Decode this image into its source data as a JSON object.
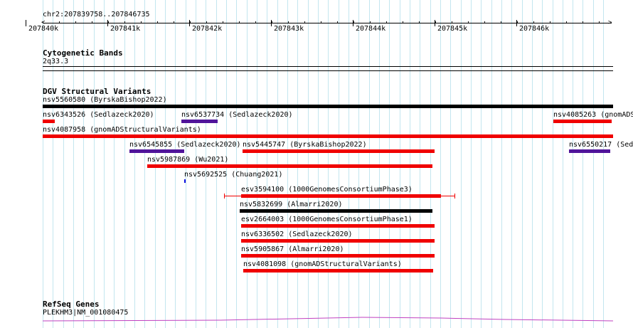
{
  "colors": {
    "grid": "#c3e6ef",
    "red": "#f00000",
    "purple": "#50149a",
    "blue": "#1010e0",
    "black": "#000000",
    "gene": "#c040c0"
  },
  "ruler": {
    "range_label": "chr2:207839758..207846735",
    "ticks": [
      {
        "label": "207840k",
        "pos": 0.035
      },
      {
        "label": "207841k",
        "pos": 0.178
      },
      {
        "label": "207842k",
        "pos": 0.322
      },
      {
        "label": "207843k",
        "pos": 0.465
      },
      {
        "label": "207844k",
        "pos": 0.608
      },
      {
        "label": "207845k",
        "pos": 0.752
      },
      {
        "label": "207846k",
        "pos": 0.895
      }
    ]
  },
  "tracks": {
    "cytoband": {
      "title": "Cytogenetic Bands",
      "band": "2q33.3"
    },
    "dgv": {
      "title": "DGV Structural Variants",
      "features": [
        {
          "label": "nsv5560580 (ByrskaBishop2022)",
          "start": 0,
          "end": 1,
          "color": "black"
        },
        {
          "label": "nsv6343526 (Sedlazeck2020)",
          "start": 0,
          "end": 0.021,
          "color": "red"
        },
        {
          "label": "nsv6537734 (Sedlazeck2020)",
          "start": 0.243,
          "end": 0.307,
          "color": "purple"
        },
        {
          "label": "nsv4085263 (gnomADS",
          "start": 0.895,
          "end": 0.998,
          "color": "red"
        },
        {
          "label": "nsv4087958 (gnomADStructuralVariants)",
          "start": 0,
          "end": 1,
          "color": "red"
        },
        {
          "label": "nsv6545855 (Sedlazeck2020)",
          "start": 0.152,
          "end": 0.248,
          "color": "purple"
        },
        {
          "label": "nsv5445747 (ByrskaBishop2022)",
          "start": 0.35,
          "end": 0.687,
          "color": "red"
        },
        {
          "label": "nsv6550217 (Sed",
          "start": 0.923,
          "end": 0.995,
          "color": "purple"
        },
        {
          "label": "nsv5987869 (Wu2021)",
          "start": 0.183,
          "end": 0.683,
          "color": "red"
        },
        {
          "label": "nsv5692525 (Chuang2021)",
          "start": 0.248,
          "end": 0.251,
          "color": "blue"
        },
        {
          "label": "esv3594100 (1000GenomesConsortiumPhase3)",
          "start": 0.348,
          "end": 0.698,
          "color": "red",
          "whisker_start": 0.318,
          "whisker_end": 0.722
        },
        {
          "label": "nsv5832699 (Almarri2020)",
          "start": 0.345,
          "end": 0.683,
          "color": "black"
        },
        {
          "label": "esv2664003 (1000GenomesConsortiumPhase1)",
          "start": 0.348,
          "end": 0.687,
          "color": "red"
        },
        {
          "label": "nsv6336502 (Sedlazeck2020)",
          "start": 0.348,
          "end": 0.687,
          "color": "red"
        },
        {
          "label": "nsv5905867 (Almarri2020)",
          "start": 0.348,
          "end": 0.687,
          "color": "red"
        },
        {
          "label": "nsv4081098 (gnomADStructuralVariants)",
          "start": 0.352,
          "end": 0.685,
          "color": "red"
        }
      ]
    },
    "refseq": {
      "title": "RefSeq Genes",
      "gene_label": "PLEKHM3|NM_001080475"
    }
  }
}
